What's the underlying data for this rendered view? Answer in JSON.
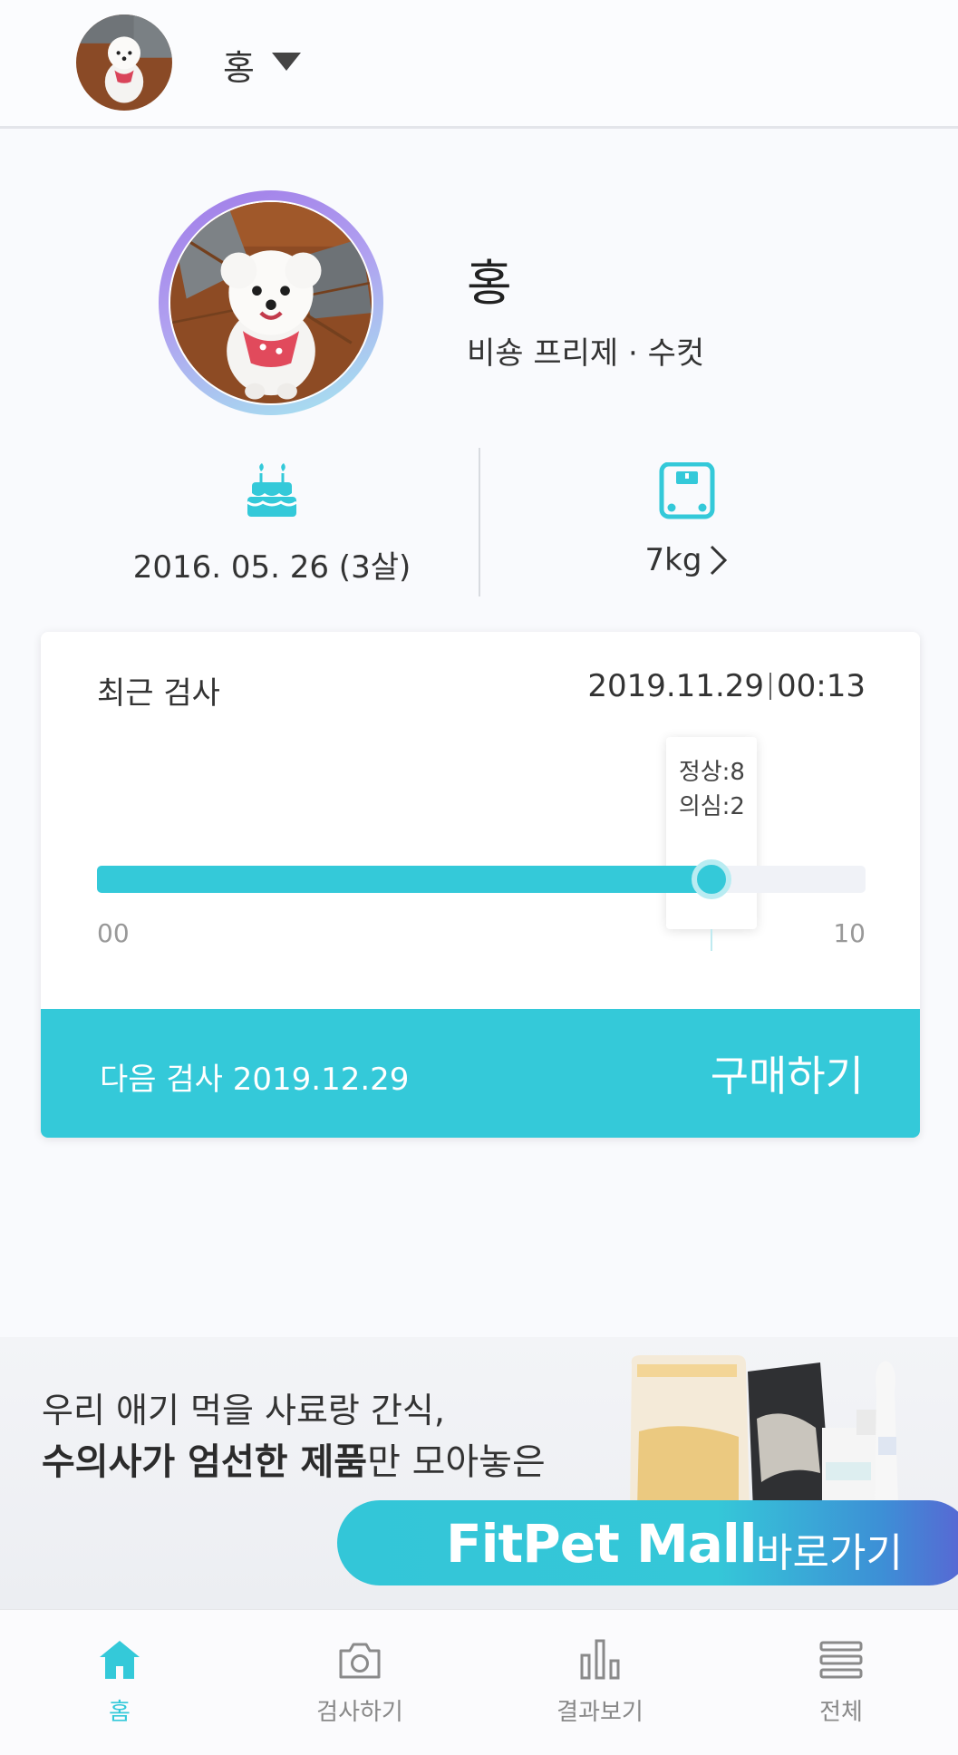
{
  "header": {
    "pet_selector_name": "홍"
  },
  "profile": {
    "name": "홍",
    "breed_gender": "비숑 프리제 · 수컷"
  },
  "stats": {
    "birthday": "2016. 05. 26 (3살)",
    "birthday_icon": "birthday-cake-icon",
    "weight": "7kg",
    "weight_icon": "scale-icon"
  },
  "recent_test": {
    "title": "최근 검사",
    "date": "2019.11.29",
    "time": "00:13",
    "normal_label": "정상:8",
    "suspect_label": "의심:2",
    "range_min": "00",
    "range_max": "10",
    "progress_value": 8,
    "progress_max": 10,
    "next_test": "다음 검사 2019.12.29",
    "buy_label": "구매하기"
  },
  "banner": {
    "line1": "우리 애기 먹을 사료랑 간식,",
    "line2_bold": "수의사가 엄선한 제품",
    "line2_rest": "만 모아놓은",
    "mall_brand": "FitPet Mall",
    "mall_go": "바로가기"
  },
  "nav": {
    "items": [
      {
        "label": "홈",
        "icon": "home-icon",
        "active": true
      },
      {
        "label": "검사하기",
        "icon": "camera-icon",
        "active": false
      },
      {
        "label": "결과보기",
        "icon": "bar-chart-icon",
        "active": false
      },
      {
        "label": "전체",
        "icon": "menu-icon",
        "active": false
      }
    ]
  },
  "colors": {
    "accent": "#34c9d9",
    "background": "#f9fafd",
    "text": "#333333"
  }
}
